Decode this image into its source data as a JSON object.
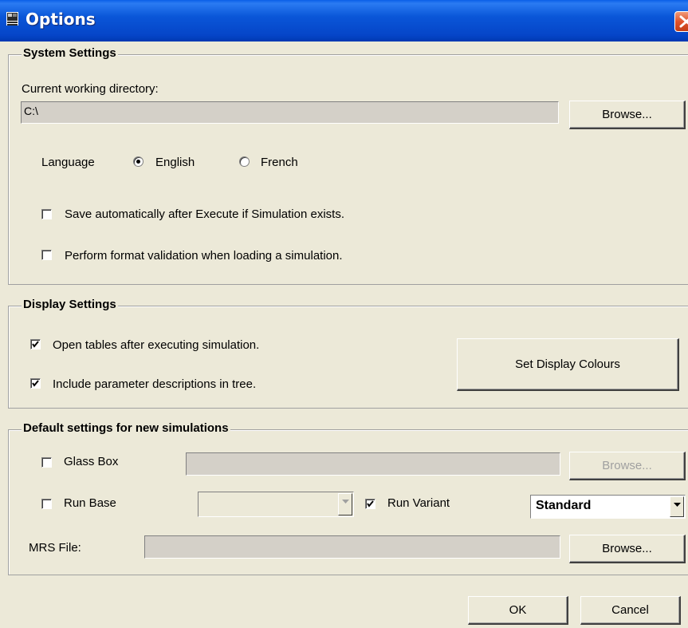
{
  "window": {
    "title": "Options",
    "titlebar_color": "#0a56d8",
    "icons": {
      "app": "app-icon",
      "close": "close-icon"
    }
  },
  "system_settings": {
    "legend": "System Settings",
    "cwd_label": "Current working directory:",
    "cwd_value": "C:\\",
    "browse_label": "Browse...",
    "language_label": "Language",
    "language_options": [
      {
        "label": "English",
        "selected": true
      },
      {
        "label": "French",
        "selected": false
      }
    ],
    "save_auto": {
      "label": "Save automatically after Execute if Simulation exists.",
      "checked": false
    },
    "format_validation": {
      "label": "Perform format validation when loading a simulation.",
      "checked": false
    }
  },
  "display_settings": {
    "legend": "Display Settings",
    "open_tables": {
      "label": "Open tables after executing simulation.",
      "checked": true
    },
    "include_params": {
      "label": "Include parameter descriptions in tree.",
      "checked": true
    },
    "set_colours_label": "Set Display Colours"
  },
  "default_settings": {
    "legend": "Default settings for new simulations",
    "glass_box": {
      "label": "Glass Box",
      "checked": false,
      "value": "",
      "browse_label": "Browse..."
    },
    "run_base": {
      "label": "Run Base",
      "checked": false,
      "value": ""
    },
    "run_variant": {
      "label": "Run Variant",
      "checked": true
    },
    "variant_select": {
      "value": "Standard"
    },
    "mrs_file": {
      "label": "MRS File:",
      "value": "",
      "browse_label": "Browse..."
    }
  },
  "footer": {
    "ok_label": "OK",
    "cancel_label": "Cancel"
  }
}
